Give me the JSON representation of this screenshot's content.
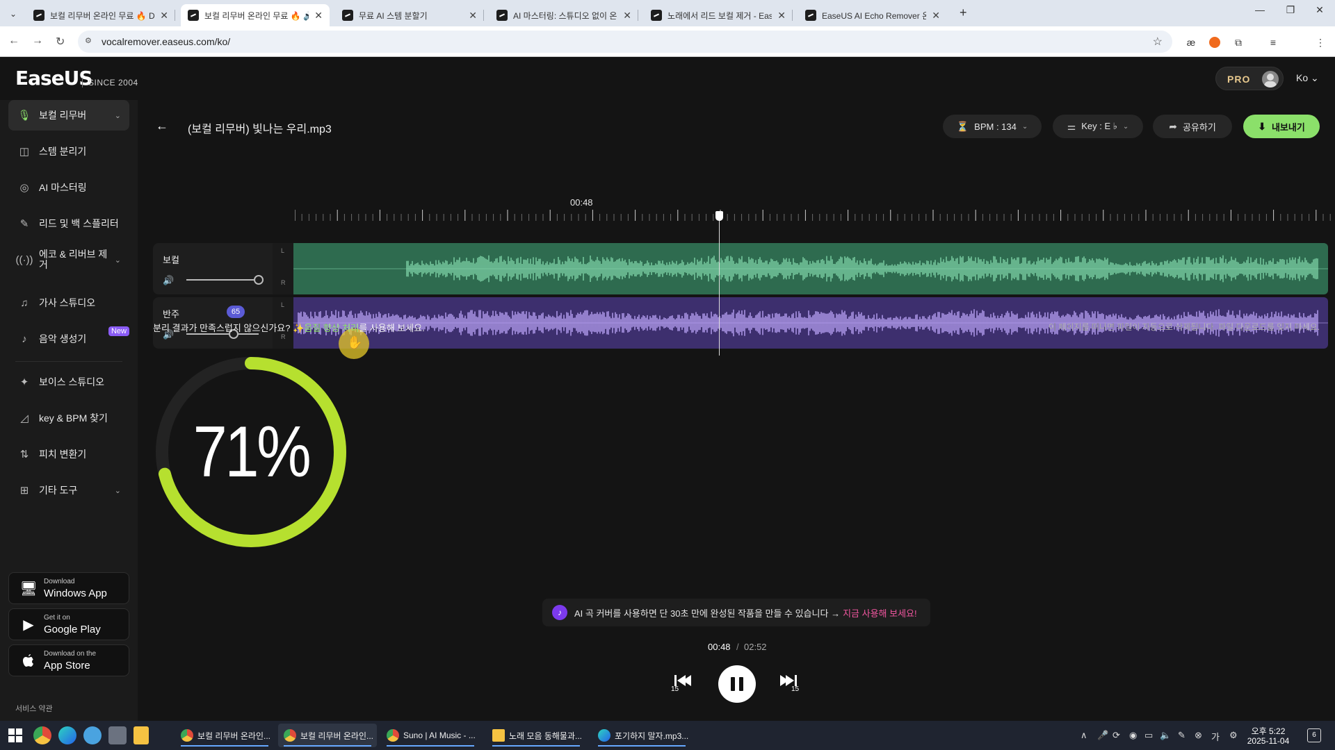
{
  "browser": {
    "tabs": [
      {
        "title": "보컬 리무버 온라인 무료 🔥 D",
        "active": false
      },
      {
        "title": "보컬 리무버 온라인 무료 🔥 🔊",
        "active": true
      },
      {
        "title": "무료 AI 스템 분할기",
        "active": false
      },
      {
        "title": "AI 마스터링: 스튜디오 없이 온",
        "active": false
      },
      {
        "title": "노래에서 리드 보컬 제거 - Ease",
        "active": false
      },
      {
        "title": "EaseUS AI Echo Remover 온라",
        "active": false
      }
    ],
    "url": "vocalremover.easeus.com/ko/"
  },
  "app": {
    "logo": "EaseUS",
    "since": "SINCE 2004",
    "pro_label": "PRO",
    "language": "Ko"
  },
  "sidebar": {
    "items": [
      {
        "label": "보컬 리무버",
        "icon": "mic-icon"
      },
      {
        "label": "스템 분리기",
        "icon": "stem-icon"
      },
      {
        "label": "AI 마스터링",
        "icon": "mastering-icon"
      },
      {
        "label": "리드 및 백 스플리터",
        "icon": "splitter-icon"
      },
      {
        "label": "에코 & 리버브 제거",
        "icon": "echo-icon"
      },
      {
        "label": "가사 스튜디오",
        "icon": "lyrics-icon"
      },
      {
        "label": "음악 생성기",
        "icon": "music-gen-icon",
        "badge": "New"
      },
      {
        "label": "보이스 스튜디오",
        "icon": "voice-icon"
      },
      {
        "label": "key & BPM 찾기",
        "icon": "key-bpm-icon"
      },
      {
        "label": "피치 변환기",
        "icon": "pitch-icon"
      },
      {
        "label": "기타 도구",
        "icon": "grid-icon"
      }
    ],
    "stores": [
      {
        "small": "Download",
        "big": "Windows App",
        "icon": "windows-icon"
      },
      {
        "small": "Get it on",
        "big": "Google Play",
        "icon": "google-play-icon"
      },
      {
        "small": "Download on the",
        "big": "App Store",
        "icon": "apple-icon"
      }
    ],
    "terms": "서비스 약관"
  },
  "editor": {
    "filename": "(보컬 리무버) 빛나는 우리.mp3",
    "bpm": "BPM : 134",
    "key": "Key : E ♭",
    "share": "공유하기",
    "export": "내보내기",
    "timecode": "00:48",
    "tracks": [
      {
        "name": "보컬",
        "volume": 100,
        "color": "#2e6b4f",
        "wave": "#7fd3a8"
      },
      {
        "name": "반주",
        "volume": 65,
        "volume_label": "65",
        "color": "#3d2f6e",
        "wave": "#b9a2f5"
      }
    ],
    "hint_left_prefix": "분리 결과가 만족스럽지 않으신가요? ",
    "hint_link": "✨음질 향상 처리",
    "hint_left_suffix": "를 사용해 보세요.",
    "hint_right": "이 페이지를 떠나면 파일이 자동으로 삭제됩니다. 파일 다운로드를 잊지 마세요.",
    "progress": {
      "percent_label": "71%",
      "value": 0.71,
      "color": "#b6e02f"
    },
    "promo_text": "AI 곡 커버를 사용하면 단 30초 만에 완성된 작품을 만들 수 있습니다 →",
    "promo_link": "지금 사용해 보세요!",
    "time_current": "00:48",
    "time_sep": "/",
    "time_total": "02:52",
    "skip_back_label": "15",
    "skip_fwd_label": "15"
  },
  "taskbar": {
    "apps": [
      {
        "label": "보컬 리무버 온라인...",
        "color": "#e04b3a"
      },
      {
        "label": "보컬 리무버 온라인...",
        "color": "#e04b3a",
        "active": true
      },
      {
        "label": "Suno | AI Music - ...",
        "color": "#e04b3a"
      },
      {
        "label": "노래 모음 동해물과...",
        "color": "#f5c242"
      },
      {
        "label": "포기하지 말자.mp3...",
        "color": "#2d7ae6"
      }
    ],
    "time": "오후 5:22",
    "date": "2025-11-04",
    "notifications": "6"
  }
}
